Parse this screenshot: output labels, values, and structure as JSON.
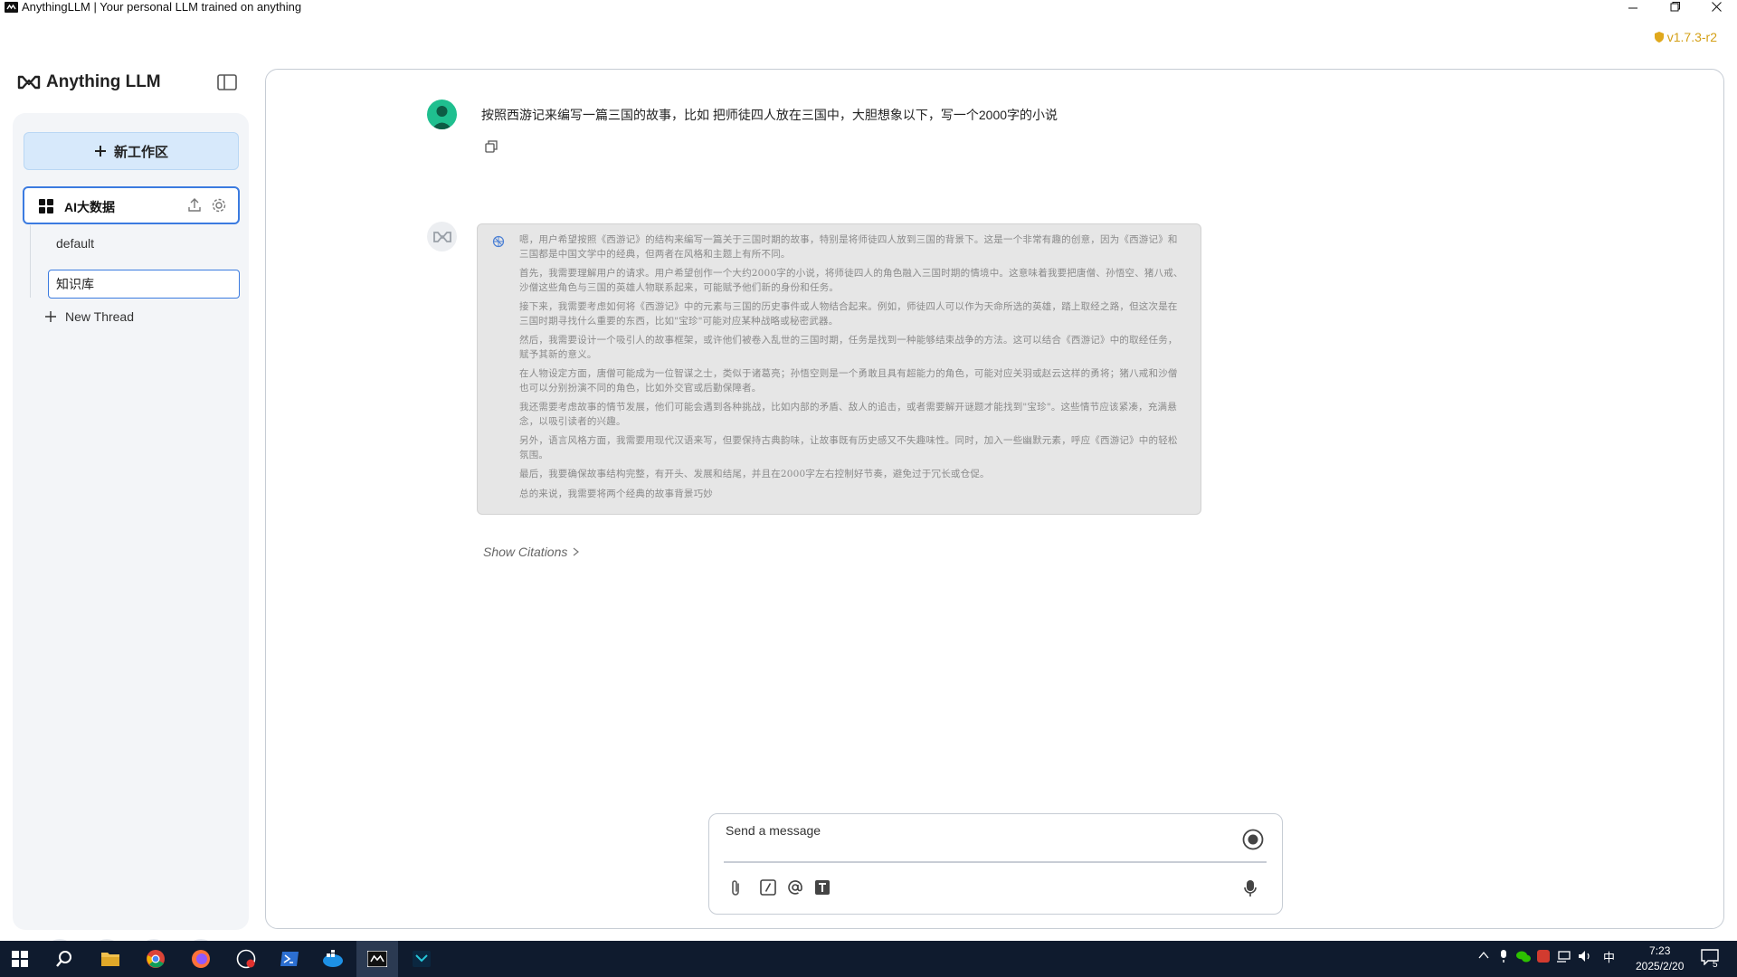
{
  "window": {
    "title": "AnythingLLM | Your personal LLM trained on anything",
    "version": "v1.7.3-r2",
    "controls": [
      "minimize",
      "maximize",
      "close"
    ]
  },
  "sidebar": {
    "logo_text": "Anything LLM",
    "new_workspace_label": "新工作区",
    "workspace": {
      "name": "AI大数据",
      "threads": [
        "default",
        "知识库"
      ],
      "new_thread_label": "New Thread"
    },
    "footer_icons": [
      "community-hub-icon",
      "docs-book-icon",
      "discord-icon",
      "settings-wrench-icon"
    ]
  },
  "chat": {
    "user_message": "按照西游记来编写一篇三国的故事，比如 把师徒四人放在三国中，大胆想象以下，写一个2000字的小说",
    "thought_lines": [
      "嗯，用户希望按照《西游记》的结构来编写一篇关于三国时期的故事，特别是将师徒四人放到三国的背景下。这是一个非常有趣的创意，因为《西游记》和三国都是中国文学中的经典，但两者在风格和主题上有所不同。",
      "首先，我需要理解用户的请求。用户希望创作一个大约2000字的小说，将师徒四人的角色融入三国时期的情境中。这意味着我要把唐僧、孙悟空、猪八戒、沙僧这些角色与三国的英雄人物联系起来，可能赋予他们新的身份和任务。",
      "接下来，我需要考虑如何将《西游记》中的元素与三国的历史事件或人物结合起来。例如，师徒四人可以作为天命所选的英雄，踏上取经之路，但这次是在三国时期寻找什么重要的东西，比如\"宝珍\"可能对应某种战略或秘密武器。",
      "然后，我需要设计一个吸引人的故事框架，或许他们被卷入乱世的三国时期，任务是找到一种能够结束战争的方法。这可以结合《西游记》中的取经任务，赋予其新的意义。",
      "在人物设定方面，唐僧可能成为一位智谋之士，类似于诸葛亮；孙悟空则是一个勇敢且具有超能力的角色，可能对应关羽或赵云这样的勇将；猪八戒和沙僧也可以分别扮演不同的角色，比如外交官或后勤保障者。",
      "我还需要考虑故事的情节发展，他们可能会遇到各种挑战，比如内部的矛盾、敌人的追击，或者需要解开谜题才能找到\"宝珍\"。这些情节应该紧凑，充满悬念，以吸引读者的兴趣。",
      "另外，语言风格方面，我需要用现代汉语来写，但要保持古典韵味，让故事既有历史感又不失趣味性。同时，加入一些幽默元素，呼应《西游记》中的轻松氛围。",
      "最后，我要确保故事结构完整，有开头、发展和结尾，并且在2000字左右控制好节奏，避免过于冗长或仓促。",
      "总的来说，我需要将两个经典的故事背景巧妙"
    ],
    "show_citations_label": "Show Citations"
  },
  "composer": {
    "placeholder": "Send a message",
    "tools": [
      "attach-icon",
      "slash-command-icon",
      "at-mention-icon",
      "text-format-icon"
    ]
  },
  "taskbar": {
    "ime_label": "中",
    "time": "7:23",
    "date": "2025/2/20",
    "notification_count": "5"
  },
  "colors": {
    "accent_blue": "#3b7be0",
    "new_workspace_bg": "#d7e9fb",
    "avatar_green": "#1fbf8f",
    "version_gold": "#d4a017",
    "taskbar_bg": "#0f1b2e"
  }
}
